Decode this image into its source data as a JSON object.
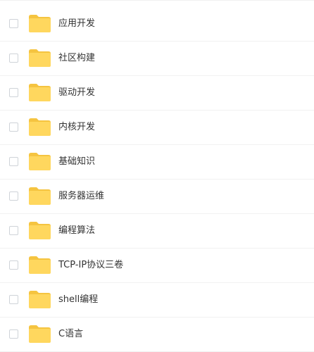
{
  "files": [
    {
      "name": "应用开发"
    },
    {
      "name": "社区构建"
    },
    {
      "name": "驱动开发"
    },
    {
      "name": "内核开发"
    },
    {
      "name": "基础知识"
    },
    {
      "name": "服务器运维"
    },
    {
      "name": "编程算法"
    },
    {
      "name": "TCP-IP协议三卷"
    },
    {
      "name": "shell编程"
    },
    {
      "name": "C语言"
    }
  ],
  "icon": "folder-icon",
  "colors": {
    "folder_body": "#FFD75E",
    "folder_tab": "#F5C440",
    "divider": "#F1F1F1",
    "text": "#333333"
  }
}
